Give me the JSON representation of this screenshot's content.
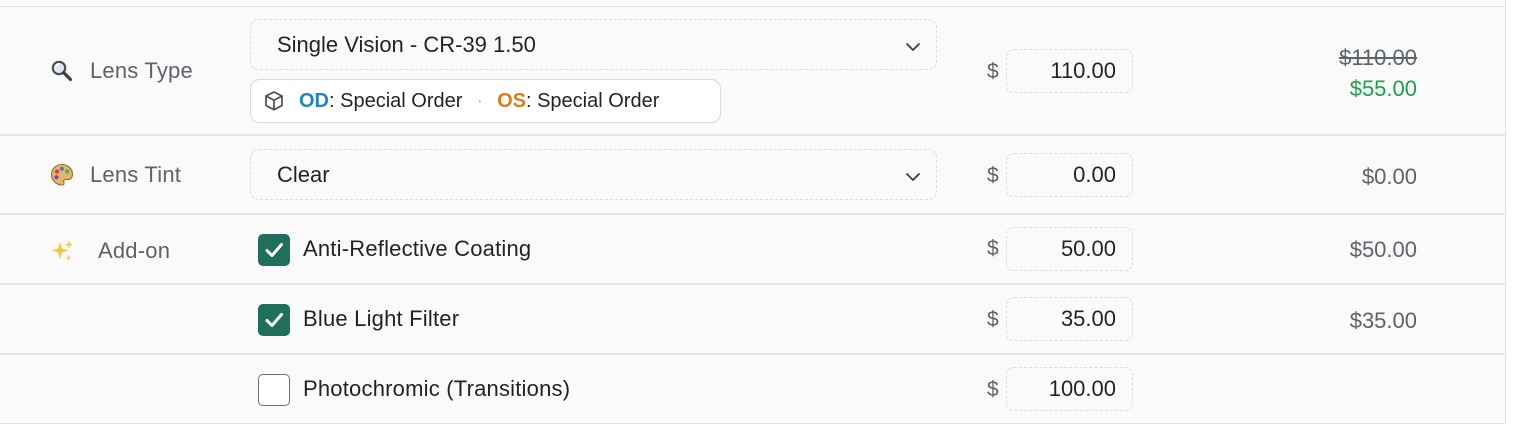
{
  "rows": {
    "lens_type": {
      "label": "Lens Type",
      "icon": "magnifier-icon",
      "select_value": "Single Vision - CR-39 1.50",
      "badge": {
        "od_label": "OD",
        "od_value": ": Special Order",
        "separator": "·",
        "os_label": "OS",
        "os_value": ": Special Order"
      },
      "currency": "$",
      "price": "110.00",
      "original_total": "$110.00",
      "discounted_total": "$55.00"
    },
    "lens_tint": {
      "label": "Lens Tint",
      "icon": "palette-icon",
      "select_value": "Clear",
      "currency": "$",
      "price": "0.00",
      "total": "$0.00"
    },
    "addons": {
      "label": "Add-on",
      "icon": "sparkles-icon",
      "items": [
        {
          "name": "Anti-Reflective Coating",
          "checked": true,
          "currency": "$",
          "price": "50.00",
          "total": "$50.00"
        },
        {
          "name": "Blue Light Filter",
          "checked": true,
          "currency": "$",
          "price": "35.00",
          "total": "$35.00"
        },
        {
          "name": "Photochromic (Transitions)",
          "checked": false,
          "currency": "$",
          "price": "100.00",
          "total": ""
        }
      ]
    }
  },
  "colors": {
    "accent": "#1f6f5c",
    "od": "#1f86c6",
    "os": "#e07b1a",
    "discount": "#1aa34a"
  }
}
